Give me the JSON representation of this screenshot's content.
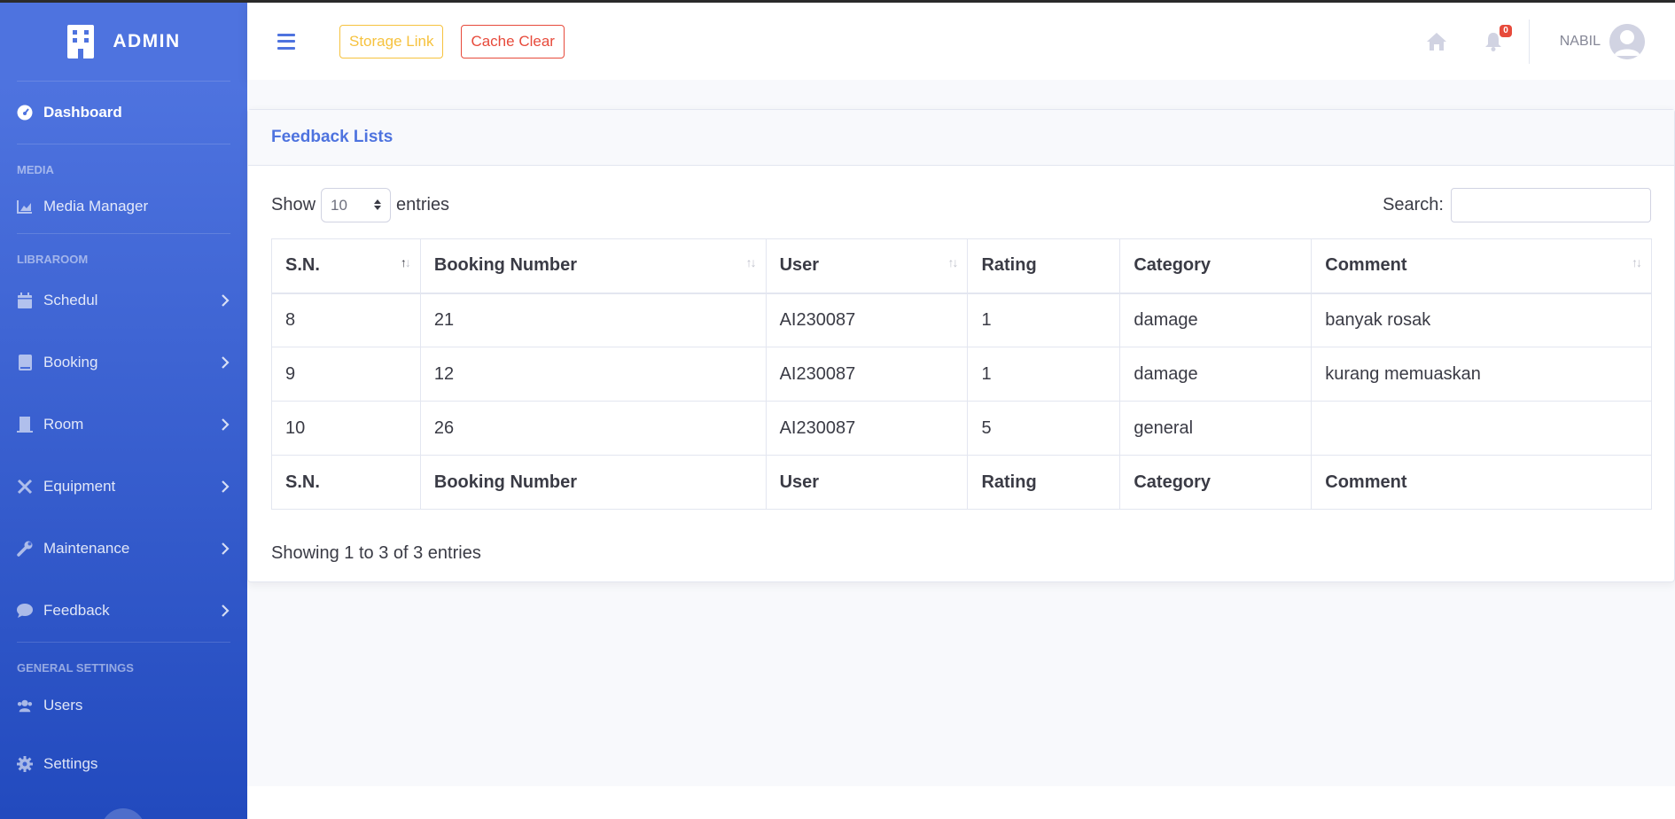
{
  "sidebar": {
    "brand": "ADMIN",
    "dashboard": "Dashboard",
    "heading_media": "MEDIA",
    "media_manager": "Media Manager",
    "heading_libraroom": "LIBRAROOM",
    "schedul": "Schedul",
    "booking": "Booking",
    "room": "Room",
    "equipment": "Equipment",
    "maintenance": "Maintenance",
    "feedback": "Feedback",
    "heading_general": "GENERAL SETTINGS",
    "users": "Users",
    "settings": "Settings"
  },
  "topbar": {
    "storage_link": "Storage Link",
    "cache_clear": "Cache Clear",
    "notification_count": "0",
    "username": "NABIL"
  },
  "card": {
    "title": "Feedback Lists",
    "show_label": "Show",
    "page_length": "10",
    "entries_label": "entries",
    "search_label": "Search:",
    "search_value": "",
    "info": "Showing 1 to 3 of 3 entries"
  },
  "table": {
    "columns": [
      "S.N.",
      "Booking Number",
      "User",
      "Rating",
      "Category",
      "Comment"
    ],
    "rows": [
      [
        "8",
        "21",
        "AI230087",
        "1",
        "damage",
        "banyak rosak"
      ],
      [
        "9",
        "12",
        "AI230087",
        "1",
        "damage",
        "kurang memuaskan"
      ],
      [
        "10",
        "26",
        "AI230087",
        "5",
        "general",
        ""
      ]
    ]
  },
  "colors": {
    "primary": "#4e73df",
    "warning": "#f6c23e",
    "danger": "#e74a3b"
  }
}
